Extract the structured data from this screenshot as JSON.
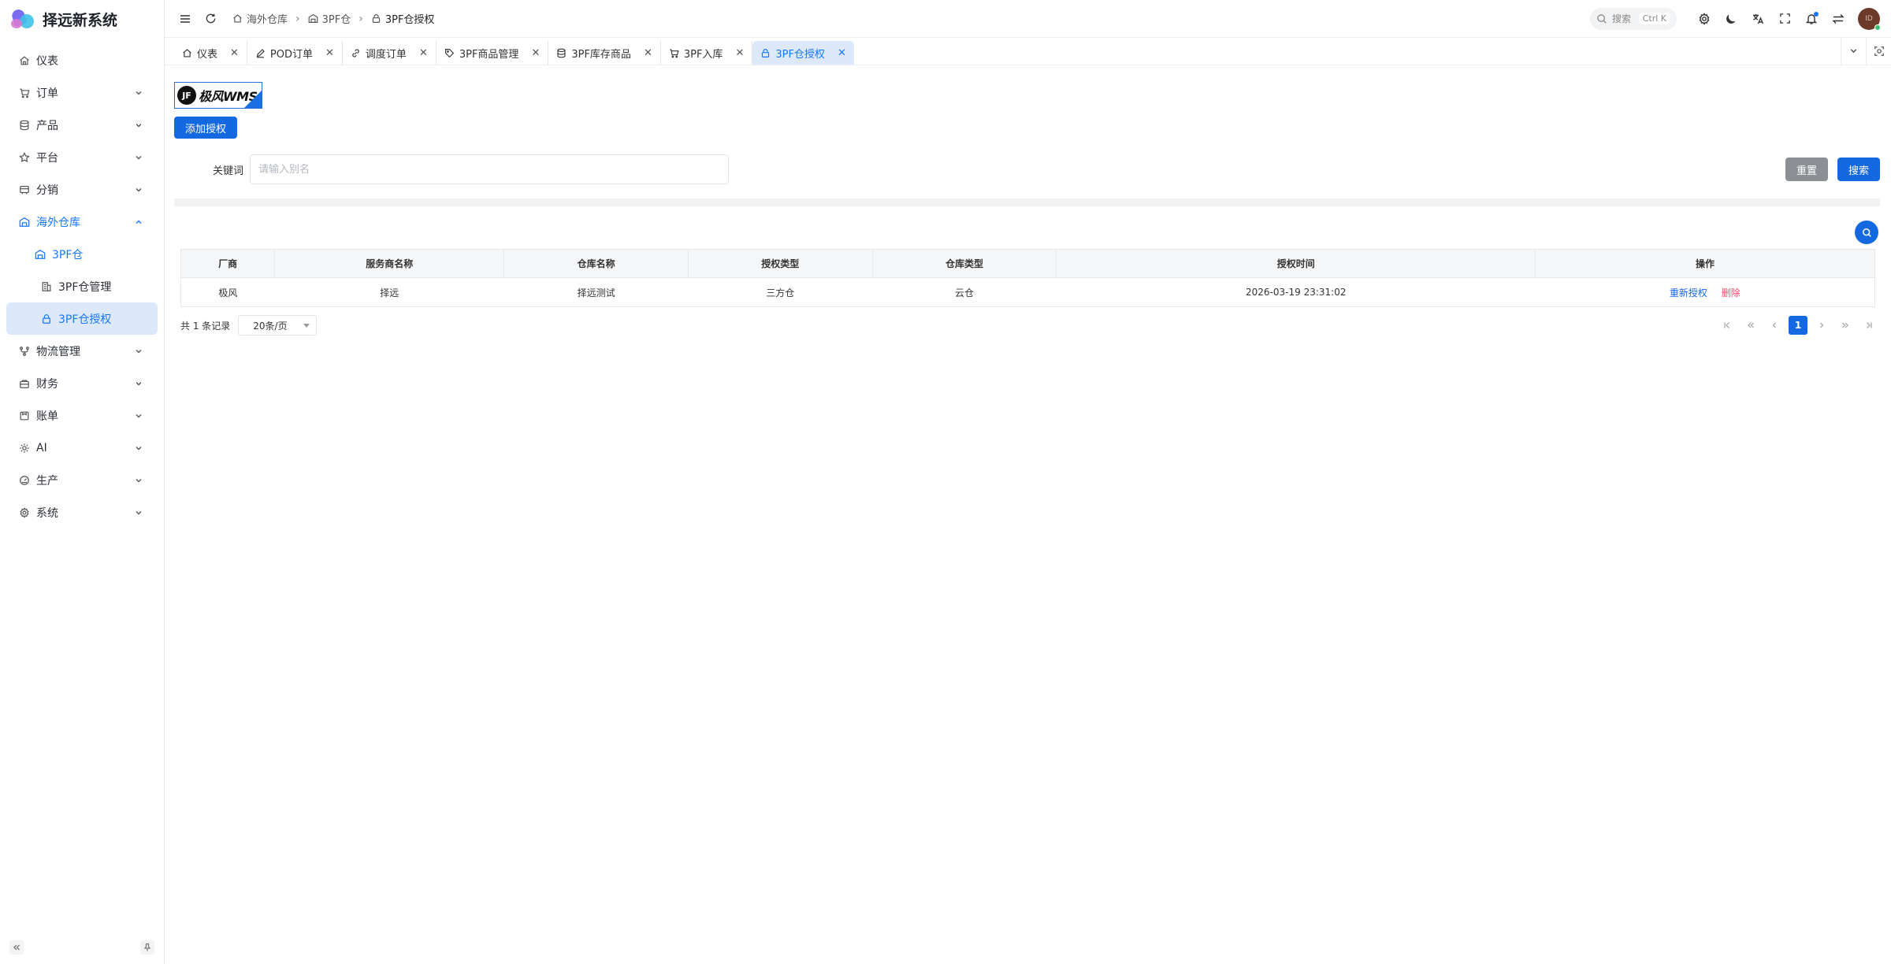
{
  "app": {
    "title": "择远新系统"
  },
  "sidebar": {
    "items": [
      {
        "label": "仪表",
        "icon": "home-icon"
      },
      {
        "label": "订单",
        "icon": "cart-icon"
      },
      {
        "label": "产品",
        "icon": "database-icon"
      },
      {
        "label": "平台",
        "icon": "star-icon"
      },
      {
        "label": "分销",
        "icon": "distribution-icon"
      },
      {
        "label": "海外仓库",
        "icon": "warehouse-icon"
      },
      {
        "label": "3PF仓",
        "icon": "warehouse-icon"
      },
      {
        "label": "3PF仓管理",
        "icon": "building-icon"
      },
      {
        "label": "3PF仓授权",
        "icon": "lock-icon"
      },
      {
        "label": "物流管理",
        "icon": "logistics-icon"
      },
      {
        "label": "财务",
        "icon": "finance-icon"
      },
      {
        "label": "账单",
        "icon": "bill-icon"
      },
      {
        "label": "AI",
        "icon": "ai-icon"
      },
      {
        "label": "生产",
        "icon": "production-icon"
      },
      {
        "label": "系统",
        "icon": "gear-icon"
      }
    ]
  },
  "header": {
    "breadcrumb": [
      "海外仓库",
      "3PF仓",
      "3PF仓授权"
    ],
    "search": {
      "label": "搜索",
      "shortcut": "Ctrl K"
    },
    "avatar_text": "ID"
  },
  "tabs": [
    {
      "label": "仪表",
      "icon": "home-icon"
    },
    {
      "label": "POD订单",
      "icon": "pen-icon"
    },
    {
      "label": "调度订单",
      "icon": "link-icon"
    },
    {
      "label": "3PF商品管理",
      "icon": "tag-icon"
    },
    {
      "label": "3PF库存商品",
      "icon": "database-icon"
    },
    {
      "label": "3PF入库",
      "icon": "cart-icon"
    },
    {
      "label": "3PF仓授权",
      "icon": "lock-icon"
    }
  ],
  "main": {
    "logo": {
      "glyph": "JF",
      "text": "极风WMS"
    },
    "add_button": "添加授权",
    "filter": {
      "label": "关键词",
      "placeholder": "请输入别名",
      "value": ""
    },
    "reset_button": "重置",
    "search_button": "搜索",
    "table": {
      "columns": [
        "厂商",
        "服务商名称",
        "仓库名称",
        "授权类型",
        "仓库类型",
        "授权时间",
        "操作"
      ],
      "rows": [
        {
          "vendor": "极风",
          "provider": "择远",
          "warehouse": "择远测试",
          "auth_type": "三方仓",
          "wh_type": "云仓",
          "auth_time": "2026-03-19 23:31:02",
          "actions": [
            "重新授权",
            "删除"
          ]
        }
      ]
    },
    "pager": {
      "total": "共 1 条记录",
      "page_size": "20条/页",
      "current_page": "1"
    }
  }
}
